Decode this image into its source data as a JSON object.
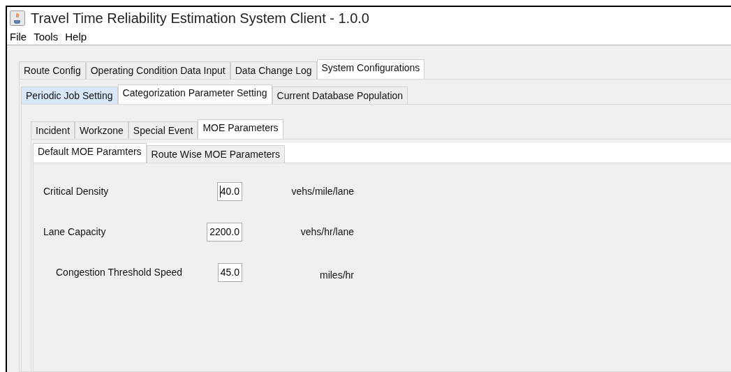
{
  "window": {
    "title": "Travel Time Reliability Estimation System Client - 1.0.0"
  },
  "menu": [
    "File",
    "Tools",
    "Help"
  ],
  "main_tabs": [
    {
      "label": "Route Config",
      "selected": false
    },
    {
      "label": "Operating Condition Data Input",
      "selected": false
    },
    {
      "label": "Data Change Log",
      "selected": false
    },
    {
      "label": "System Configurations",
      "selected": true
    }
  ],
  "config_tabs": [
    {
      "label": "Periodic Job Setting",
      "selected": false,
      "highlighted": true
    },
    {
      "label": "Categorization Parameter Setting",
      "selected": true,
      "highlighted": false
    },
    {
      "label": "Current Database Population",
      "selected": false,
      "highlighted": false
    }
  ],
  "category_tabs": [
    {
      "label": "Incident",
      "selected": false
    },
    {
      "label": "Workzone",
      "selected": false
    },
    {
      "label": "Special Event",
      "selected": false
    },
    {
      "label": "MOE Parameters",
      "selected": true
    }
  ],
  "moe_tabs": [
    {
      "label": "Default MOE Paramters",
      "selected": true
    },
    {
      "label": "Route Wise MOE Parameters",
      "selected": false
    }
  ],
  "fields": [
    {
      "label": "Critical Density",
      "value": "40.0",
      "unit": "vehs/mile/lane",
      "focused": true
    },
    {
      "label": "Lane Capacity",
      "value": "2200.0",
      "unit": "vehs/hr/lane",
      "focused": false
    },
    {
      "label": "Congestion Threshold Speed",
      "value": "45.0",
      "unit": "miles/hr",
      "focused": false
    }
  ]
}
